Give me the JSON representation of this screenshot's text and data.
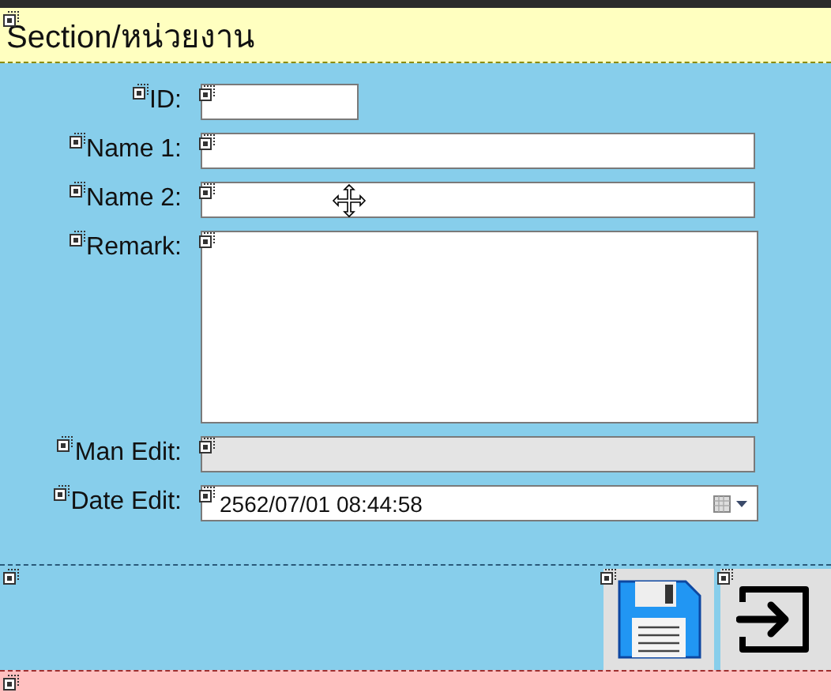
{
  "header": {
    "title": "Section/หน่วยงาน"
  },
  "fields": [
    {
      "label": "ID:",
      "kind": "short",
      "disabled": false
    },
    {
      "label": "Name 1:",
      "kind": "text",
      "disabled": false
    },
    {
      "label": "Name 2:",
      "kind": "text",
      "disabled": false
    },
    {
      "label": "Remark:",
      "kind": "memo",
      "disabled": false
    },
    {
      "label": "Man Edit:",
      "kind": "text",
      "disabled": true
    },
    {
      "label": "Date Edit:",
      "kind": "date",
      "value": "2562/07/01 08:44:58",
      "disabled": false
    }
  ],
  "footer_buttons": [
    {
      "kind": "save"
    },
    {
      "kind": "exit"
    }
  ]
}
